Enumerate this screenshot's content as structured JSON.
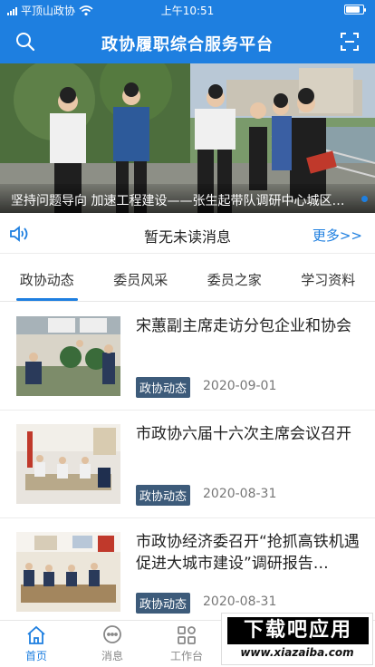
{
  "status_bar": {
    "carrier": "平顶山政协",
    "time": "上午10:51",
    "battery_level": 0.85
  },
  "header": {
    "title": "政协履职综合服务平台",
    "left_icon": "search-icon",
    "right_icon": "scan-icon"
  },
  "banner": {
    "caption": "坚持问题导向  加速工程建设——张生起带队调研中心城区…"
  },
  "notice": {
    "message": "暂无未读消息",
    "more_label": "更多>>",
    "icon": "speaker-icon"
  },
  "tabs": [
    {
      "label": "政协动态",
      "active": true
    },
    {
      "label": "委员风采",
      "active": false
    },
    {
      "label": "委员之家",
      "active": false
    },
    {
      "label": "学习资料",
      "active": false
    }
  ],
  "news": [
    {
      "title": "宋蕙副主席走访分包企业和协会",
      "tag": "政协动态",
      "date": "2020-09-01"
    },
    {
      "title": "市政协六届十六次主席会议召开",
      "tag": "政协动态",
      "date": "2020-08-31"
    },
    {
      "title": "市政协经济委召开“抢抓高铁机遇 促进大城市建设”调研报告…",
      "tag": "政协动态",
      "date": "2020-08-31"
    }
  ],
  "bottom_nav": [
    {
      "label": "首页",
      "icon": "home-icon",
      "active": true
    },
    {
      "label": "消息",
      "icon": "message-icon",
      "active": false
    },
    {
      "label": "工作台",
      "icon": "workbench-icon",
      "active": false
    }
  ],
  "watermark": {
    "text": "下载吧应用",
    "url": "www.xiazaiba.com"
  },
  "colors": {
    "brand": "#1e7fe0",
    "tag_bg": "#3d5b7a"
  }
}
